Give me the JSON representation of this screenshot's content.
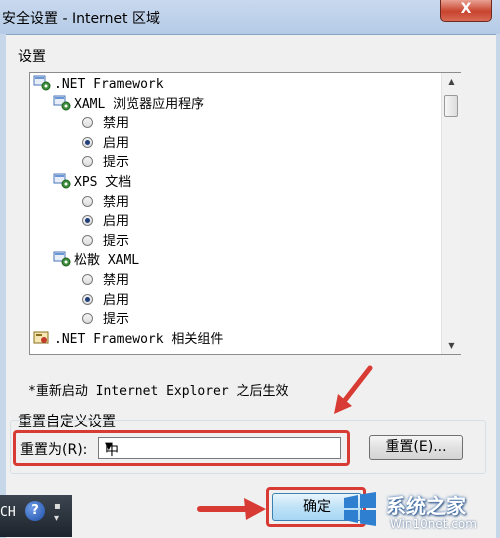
{
  "window": {
    "title": "安全设置 - Internet 区域",
    "close_glyph": "X"
  },
  "settings_label": "设置",
  "tree": [
    {
      "kind": "node",
      "text": ".NET Framework",
      "icon": "settings-icon"
    },
    {
      "kind": "node",
      "text": "XAML 浏览器应用程序",
      "icon": "settings-icon"
    },
    {
      "kind": "radio",
      "text": "禁用",
      "checked": false
    },
    {
      "kind": "radio",
      "text": "启用",
      "checked": true
    },
    {
      "kind": "radio",
      "text": "提示",
      "checked": false
    },
    {
      "kind": "node",
      "text": "XPS 文档",
      "icon": "settings-icon"
    },
    {
      "kind": "radio",
      "text": "禁用",
      "checked": false
    },
    {
      "kind": "radio",
      "text": "启用",
      "checked": true
    },
    {
      "kind": "radio",
      "text": "提示",
      "checked": false
    },
    {
      "kind": "node",
      "text": "松散 XAML",
      "icon": "settings-icon"
    },
    {
      "kind": "radio",
      "text": "禁用",
      "checked": false
    },
    {
      "kind": "radio",
      "text": "启用",
      "checked": true
    },
    {
      "kind": "radio",
      "text": "提示",
      "checked": false
    },
    {
      "kind": "node",
      "text": ".NET Framework 相关组件",
      "icon": "certificate-icon"
    }
  ],
  "restart_note": "*重新启动 Internet Explorer 之后生效",
  "reset_group": {
    "title": "重置自定义设置",
    "reset_to_label": "重置为(R):",
    "selected_level": "中",
    "reset_button": "重置(E)..."
  },
  "ok_button": "确定",
  "taskbar": {
    "lang": "CH",
    "help_glyph": "?"
  },
  "watermark": {
    "title": "系统之家",
    "url": "Win10net.com"
  },
  "colors": {
    "highlight_red": "#d83b33",
    "titlebar": "#c9d9ee",
    "dialog_bg": "#f0f0f0"
  }
}
